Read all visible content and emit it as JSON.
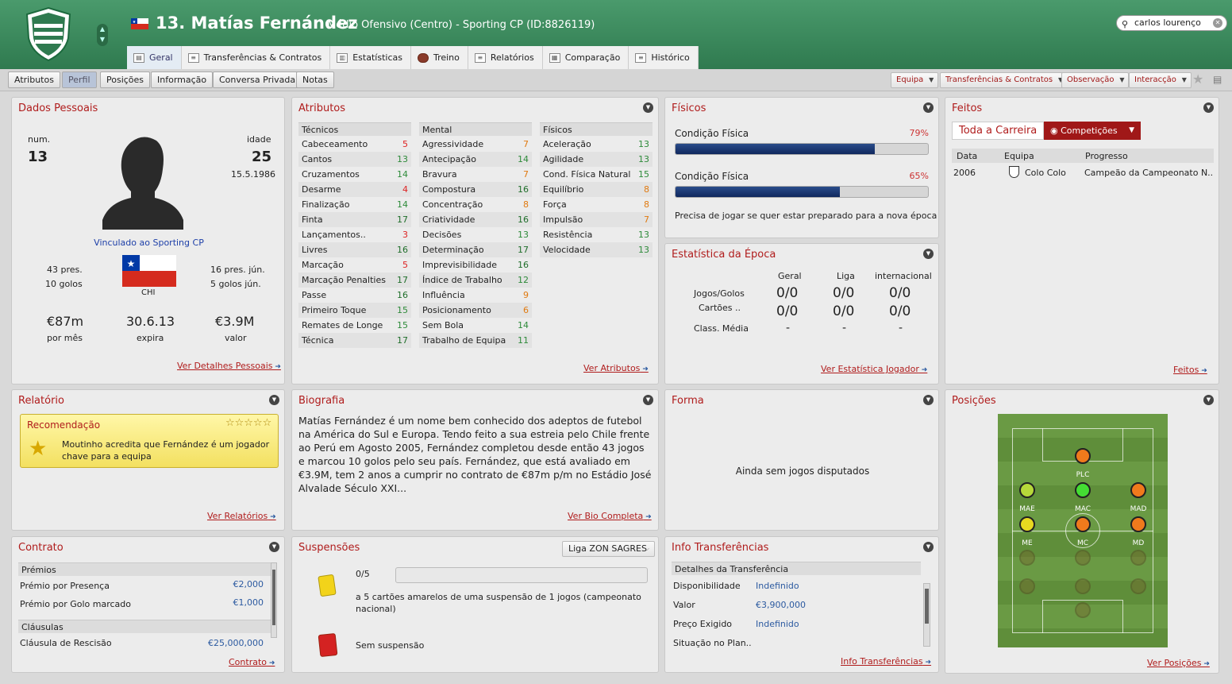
{
  "header": {
    "name": "13. Matías Fernández",
    "subtitle": "Médio Ofensivo (Centro) - Sporting CP (ID:8826119)",
    "search": "carlos lourenço"
  },
  "tabs": [
    {
      "label": "Geral",
      "icon": "overview-icon"
    },
    {
      "label": "Transferências & Contratos",
      "icon": "contract-icon"
    },
    {
      "label": "Estatísticas",
      "icon": "stats-icon"
    },
    {
      "label": "Treino",
      "icon": "training-icon"
    },
    {
      "label": "Relatórios",
      "icon": "report-icon"
    },
    {
      "label": "Comparação",
      "icon": "compare-icon"
    },
    {
      "label": "Histórico",
      "icon": "history-icon"
    }
  ],
  "subtabs": [
    "Atributos",
    "Perfil",
    "Posições",
    "Informação",
    "Conversa Privada",
    "Notas"
  ],
  "actions": [
    "Equipa",
    "Transferências & Contratos",
    "Observação",
    "Interacção"
  ],
  "personal": {
    "title": "Dados Pessoais",
    "num_label": "num.",
    "num": "13",
    "age_label": "idade",
    "age": "25",
    "dob": "15.5.1986",
    "club": "Vinculado ao Sporting CP",
    "caps": "43 pres.",
    "goals": "10 golos",
    "youth_caps": "16 pres. jún.",
    "youth_goals": "5 golos jún.",
    "nation": "CHI",
    "wage": "€87m",
    "wage_label": "por mês",
    "expiry": "30.6.13",
    "expiry_label": "expira",
    "value": "€3.9M",
    "value_label": "valor",
    "link": "Ver Detalhes Pessoais"
  },
  "attributes": {
    "title": "Atributos",
    "link": "Ver Atributos",
    "tecnicos": {
      "header": "Técnicos",
      "rows": [
        [
          "Cabeceamento",
          "5"
        ],
        [
          "Cantos",
          "13"
        ],
        [
          "Cruzamentos",
          "14"
        ],
        [
          "Desarme",
          "4"
        ],
        [
          "Finalização",
          "14"
        ],
        [
          "Finta",
          "17"
        ],
        [
          "Lançamentos..",
          "3"
        ],
        [
          "Livres",
          "16"
        ],
        [
          "Marcação",
          "5"
        ],
        [
          "Marcação Penalties",
          "17"
        ],
        [
          "Passe",
          "16"
        ],
        [
          "Primeiro Toque",
          "15"
        ],
        [
          "Remates de Longe",
          "15"
        ],
        [
          "Técnica",
          "17"
        ]
      ]
    },
    "mental": {
      "header": "Mental",
      "rows": [
        [
          "Agressividade",
          "7"
        ],
        [
          "Antecipação",
          "14"
        ],
        [
          "Bravura",
          "7"
        ],
        [
          "Compostura",
          "16"
        ],
        [
          "Concentração",
          "8"
        ],
        [
          "Criatividade",
          "16"
        ],
        [
          "Decisões",
          "13"
        ],
        [
          "Determinação",
          "17"
        ],
        [
          "Imprevisibilidade",
          "16"
        ],
        [
          "Índice de Trabalho",
          "12"
        ],
        [
          "Influência",
          "9"
        ],
        [
          "Posicionamento",
          "6"
        ],
        [
          "Sem Bola",
          "14"
        ],
        [
          "Trabalho de Equipa",
          "11"
        ]
      ]
    },
    "fisicos": {
      "header": "Físicos",
      "rows": [
        [
          "Aceleração",
          "13"
        ],
        [
          "Agilidade",
          "13"
        ],
        [
          "Cond. Física Natural",
          "15"
        ],
        [
          "Equilíbrio",
          "8"
        ],
        [
          "Força",
          "8"
        ],
        [
          "Impulsão",
          "7"
        ],
        [
          "Resistência",
          "13"
        ],
        [
          "Velocidade",
          "13"
        ]
      ]
    }
  },
  "physical": {
    "title": "Físicos",
    "cond1_label": "Condição Física",
    "cond1": "79%",
    "cond1_value": 0.79,
    "cond2_label": "Condição Física",
    "cond2": "65%",
    "cond2_value": 0.65,
    "note": "Precisa de jogar se quer estar preparado para a nova época"
  },
  "season": {
    "title": "Estatística da Época",
    "cols": [
      "Geral",
      "Liga",
      "internacional"
    ],
    "row1": "Jogos/Golos",
    "row2": "Cartões ..",
    "row3": "Class. Média",
    "games": [
      "0/0",
      "0/0",
      "0/0"
    ],
    "cards": [
      "0/0",
      "0/0",
      "0/0"
    ],
    "avg": [
      "-",
      "-",
      "-"
    ],
    "link": "Ver Estatística Jogador"
  },
  "feats": {
    "title": "Feitos",
    "tab1": "Toda a Carreira",
    "tab2": "Competições",
    "headers": [
      "Data",
      "Equipa",
      "Progresso"
    ],
    "row": [
      "2006",
      "Colo Colo",
      "Campeão da Campeonato N.."
    ],
    "link": "Feitos"
  },
  "report": {
    "title": "Relatório",
    "box_title": "Recomendação",
    "text": "Moutinho acredita que Fernández é um jogador chave para a equipa",
    "stars": "☆☆☆☆☆",
    "link": "Ver Relatórios"
  },
  "bio": {
    "title": "Biografia",
    "text": "Matías Fernández é um nome bem conhecido dos adeptos de futebol na América do Sul e Europa. Tendo feito a sua estreia pelo Chile frente ao Perú em Agosto 2005, Fernández completou desde então 43 jogos e marcou 10 golos pelo seu país. Fernández, que está avaliado em €3.9M, tem 2 anos a cumprir no contrato de €87m p/m no Estádio José Alvalade Século XXI...",
    "link": "Ver Bio Completa"
  },
  "form": {
    "title": "Forma",
    "text": "Ainda sem jogos disputados"
  },
  "positions": {
    "title": "Posições",
    "link": "Ver Posições",
    "labels": [
      "PLC",
      "MAE",
      "MAC",
      "MAD",
      "ME",
      "MC",
      "MD"
    ]
  },
  "contract": {
    "title": "Contrato",
    "sec1": "Prémios",
    "r1": [
      "Prémio por Presença",
      "€2,000"
    ],
    "r2": [
      "Prémio por Golo marcado",
      "€1,000"
    ],
    "sec2": "Cláusulas",
    "r3": [
      "Cláusula de Rescisão",
      "€25,000,000"
    ],
    "link": "Contrato"
  },
  "suspensions": {
    "title": "Suspensões",
    "league": "Liga ZON SAGRES",
    "count": "0/5",
    "yellow_text": "a 5 cartões amarelos de uma suspensão de 1 jogos (campeonato nacional)",
    "red_text": "Sem suspensão"
  },
  "transfer": {
    "title": "Info Transferências",
    "header": "Detalhes da Transferência",
    "r1": [
      "Disponibilidade",
      "Indefinido"
    ],
    "r2": [
      "Valor",
      "€3,900,000"
    ],
    "r3": [
      "Preço Exigido",
      "Indefinido"
    ],
    "r4": [
      "Situação no Plan..",
      ""
    ],
    "link": "Info Transferências"
  },
  "colors": {
    "header_green": "#3a8a5c",
    "accent_red": "#b01c1c",
    "link_blue": "#2c5aa0"
  }
}
